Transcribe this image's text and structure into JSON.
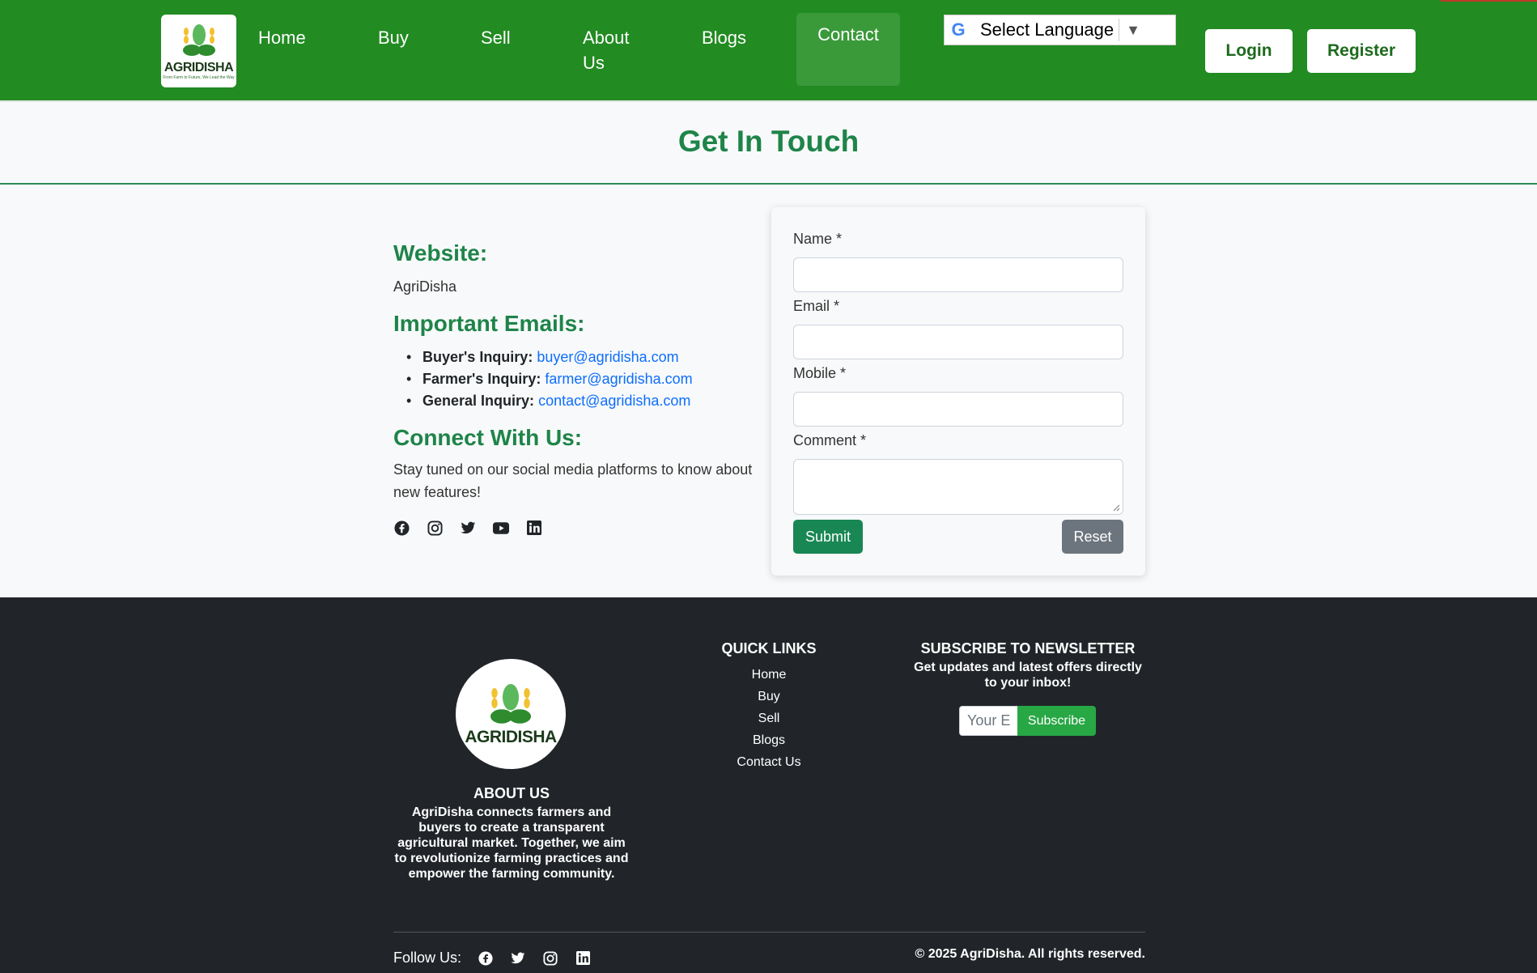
{
  "header": {
    "logo_text": "AGRIDISHA",
    "logo_tagline": "From Farm to Future, We Lead the Way",
    "nav": [
      "Home",
      "Buy",
      "Sell",
      "About Us",
      "Blogs",
      "Contact"
    ],
    "language_select": "Select Language",
    "login_label": "Login",
    "register_label": "Register"
  },
  "page": {
    "title": "Get In Touch"
  },
  "info": {
    "website_heading": "Website:",
    "website_value": "AgriDisha",
    "emails_heading": "Important Emails:",
    "emails": [
      {
        "label": "Buyer's Inquiry:",
        "email": "buyer@agridisha.com"
      },
      {
        "label": "Farmer's Inquiry:",
        "email": "farmer@agridisha.com"
      },
      {
        "label": "General Inquiry:",
        "email": "contact@agridisha.com"
      }
    ],
    "connect_heading": "Connect With Us:",
    "connect_text": "Stay tuned on our social media platforms to know about new features!",
    "socials": [
      "facebook-icon",
      "instagram-icon",
      "twitter-icon",
      "youtube-icon",
      "linkedin-icon"
    ]
  },
  "form": {
    "name_label": "Name *",
    "email_label": "Email *",
    "mobile_label": "Mobile *",
    "comment_label": "Comment *",
    "submit_label": "Submit",
    "reset_label": "Reset"
  },
  "footer": {
    "logo_text": "AGRIDISHA",
    "about_heading": "ABOUT US",
    "about_text": "AgriDisha connects farmers and buyers to create a transparent agricultural market. Together, we aim to revolutionize farming practices and empower the farming community.",
    "quick_links_heading": "QUICK LINKS",
    "quick_links": [
      "Home",
      "Buy",
      "Sell",
      "Blogs",
      "Contact Us"
    ],
    "newsletter_heading": "SUBSCRIBE TO NEWSLETTER",
    "newsletter_text": "Get updates and latest offers directly to your inbox!",
    "email_placeholder": "Your E",
    "subscribe_label": "Subscribe",
    "follow_label": "Follow Us:",
    "copyright": "© 2025 AgriDisha. All rights reserved."
  },
  "colors": {
    "header_bg": "#228b22",
    "accent_green": "#1e8449",
    "submit_green": "#198754",
    "footer_bg": "#212529",
    "link_blue": "#0d6efd"
  }
}
